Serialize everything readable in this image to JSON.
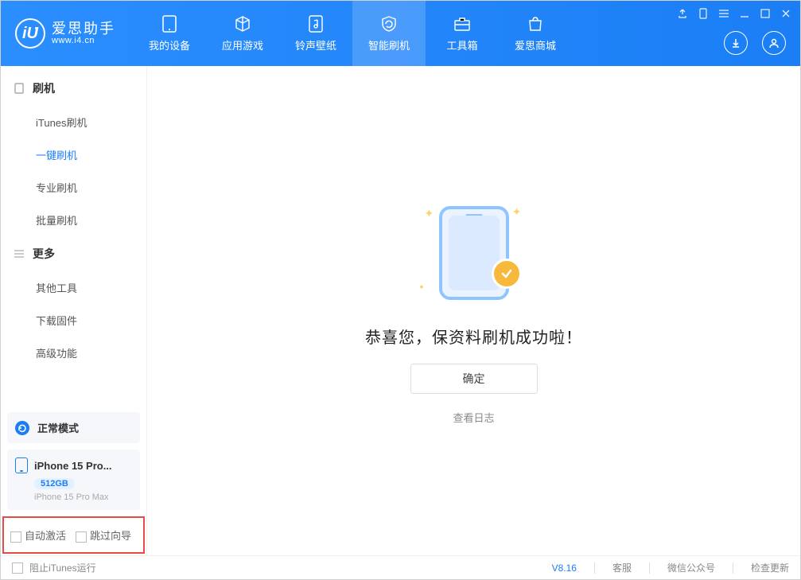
{
  "app": {
    "name_zh": "爱思助手",
    "url": "www.i4.cn"
  },
  "nav": {
    "tabs": [
      {
        "label": "我的设备",
        "icon": "device"
      },
      {
        "label": "应用游戏",
        "icon": "cube"
      },
      {
        "label": "铃声壁纸",
        "icon": "music"
      },
      {
        "label": "智能刷机",
        "icon": "refresh",
        "active": true
      },
      {
        "label": "工具箱",
        "icon": "toolbox"
      },
      {
        "label": "爱思商城",
        "icon": "shop"
      }
    ]
  },
  "sidebar": {
    "group1_title": "刷机",
    "items1": [
      {
        "label": "iTunes刷机"
      },
      {
        "label": "一键刷机",
        "active": true
      },
      {
        "label": "专业刷机"
      },
      {
        "label": "批量刷机"
      }
    ],
    "group2_title": "更多",
    "items2": [
      {
        "label": "其他工具"
      },
      {
        "label": "下载固件"
      },
      {
        "label": "高级功能"
      }
    ],
    "mode_label": "正常模式",
    "device": {
      "name": "iPhone 15 Pro...",
      "storage": "512GB",
      "full": "iPhone 15 Pro Max"
    },
    "check_auto_activate": "自动激活",
    "check_skip_guide": "跳过向导"
  },
  "main": {
    "success_text": "恭喜您，保资料刷机成功啦！",
    "ok_label": "确定",
    "log_link": "查看日志"
  },
  "footer": {
    "block_itunes": "阻止iTunes运行",
    "version": "V8.16",
    "support": "客服",
    "wechat": "微信公众号",
    "check_update": "检查更新"
  }
}
